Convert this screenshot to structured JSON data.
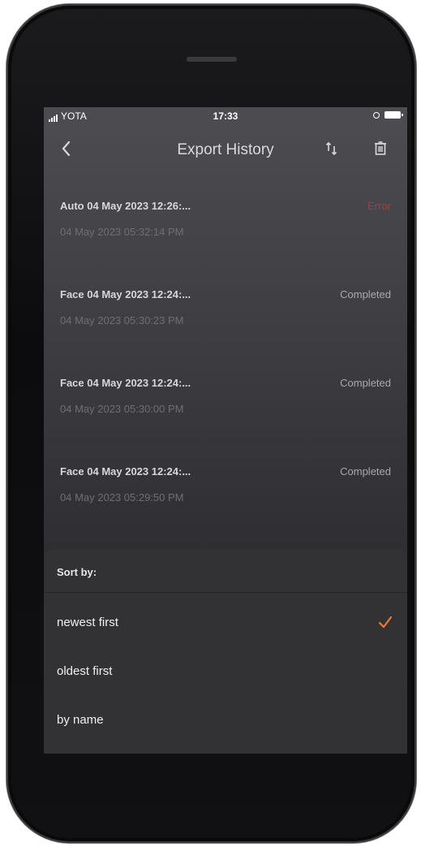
{
  "status_bar": {
    "carrier": "YOTA",
    "time": "17:33"
  },
  "nav": {
    "title": "Export History",
    "back_icon": "chevron-left-icon",
    "sort_icon": "sort-arrows-icon",
    "trash_icon": "trash-icon"
  },
  "exports": [
    {
      "title": "Auto 04 May 2023 12:26:...",
      "date": "04 May 2023 05:32:14 PM",
      "status": "Error"
    },
    {
      "title": "Face 04 May 2023 12:24:...",
      "date": "04 May 2023 05:30:23 PM",
      "status": "Completed"
    },
    {
      "title": "Face 04 May 2023 12:24:...",
      "date": "04 May 2023 05:30:00 PM",
      "status": "Completed"
    },
    {
      "title": "Face 04 May 2023 12:24:...",
      "date": "04 May 2023 05:29:50 PM",
      "status": "Completed"
    }
  ],
  "sort_sheet": {
    "title": "Sort by:",
    "options": [
      {
        "label": "newest first",
        "selected": true
      },
      {
        "label": "oldest first",
        "selected": false
      },
      {
        "label": "by name",
        "selected": false
      }
    ]
  },
  "colors": {
    "error": "#b13a36",
    "accent_check": "#e8793a"
  }
}
